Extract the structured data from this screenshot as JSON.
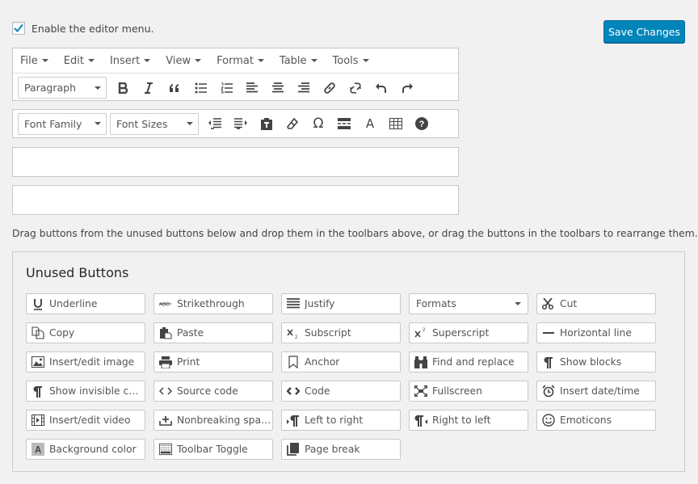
{
  "enable_menu": {
    "label": "Enable the editor menu.",
    "checked": true
  },
  "save_button": {
    "label": "Save Changes"
  },
  "menubar": {
    "items": [
      "File",
      "Edit",
      "Insert",
      "View",
      "Format",
      "Table",
      "Tools"
    ]
  },
  "toolbar1": {
    "format_select": "Paragraph",
    "icons": [
      "bold-icon",
      "italic-icon",
      "blockquote-icon",
      "bullet-list-icon",
      "numbered-list-icon",
      "align-left-icon",
      "align-center-icon",
      "align-right-icon",
      "link-icon",
      "unlink-icon",
      "undo-icon",
      "redo-icon"
    ]
  },
  "toolbar2": {
    "font_family_select": "Font Family",
    "font_size_select": "Font Sizes",
    "icons": [
      "outdent-icon",
      "indent-icon",
      "paste-text-icon",
      "clear-formatting-icon",
      "special-character-icon",
      "read-more-icon",
      "text-color-icon",
      "table-icon",
      "help-icon"
    ]
  },
  "help_text": "Drag buttons from the unused buttons below and drop them in the toolbars above, or drag the buttons in the toolbars to rearrange them.",
  "unused": {
    "title": "Unused Buttons",
    "buttons": [
      {
        "label": "Underline",
        "icon": "underline-icon"
      },
      {
        "label": "Strikethrough",
        "icon": "strikethrough-icon"
      },
      {
        "label": "Justify",
        "icon": "justify-icon"
      },
      {
        "label": "Formats",
        "icon": "dropdown-caret-icon"
      },
      {
        "label": "Cut",
        "icon": "scissors-icon"
      },
      {
        "label": "Copy",
        "icon": "copy-icon"
      },
      {
        "label": "Paste",
        "icon": "paste-icon"
      },
      {
        "label": "Subscript",
        "icon": "subscript-icon"
      },
      {
        "label": "Superscript",
        "icon": "superscript-icon"
      },
      {
        "label": "Horizontal line",
        "icon": "horizontal-line-icon"
      },
      {
        "label": "Insert/edit image",
        "icon": "image-icon"
      },
      {
        "label": "Print",
        "icon": "print-icon"
      },
      {
        "label": "Anchor",
        "icon": "bookmark-icon"
      },
      {
        "label": "Find and replace",
        "icon": "binoculars-icon"
      },
      {
        "label": "Show blocks",
        "icon": "pilcrow-icon"
      },
      {
        "label": "Show invisible chara...",
        "icon": "pilcrow-icon"
      },
      {
        "label": "Source code",
        "icon": "source-code-icon"
      },
      {
        "label": "Code",
        "icon": "code-icon"
      },
      {
        "label": "Fullscreen",
        "icon": "fullscreen-icon"
      },
      {
        "label": "Insert date/time",
        "icon": "alarm-clock-icon"
      },
      {
        "label": "Insert/edit video",
        "icon": "video-icon"
      },
      {
        "label": "Nonbreaking space",
        "icon": "nonbreaking-space-icon"
      },
      {
        "label": "Left to right",
        "icon": "ltr-icon"
      },
      {
        "label": "Right to left",
        "icon": "rtl-icon"
      },
      {
        "label": "Emoticons",
        "icon": "smiley-icon"
      },
      {
        "label": "Background color",
        "icon": "background-color-icon"
      },
      {
        "label": "Toolbar Toggle",
        "icon": "keyboard-icon"
      },
      {
        "label": "Page break",
        "icon": "page-break-icon"
      }
    ]
  },
  "colors": {
    "primary": "#0085ba",
    "background": "#f1f1f1",
    "border": "#c8c8c8"
  }
}
